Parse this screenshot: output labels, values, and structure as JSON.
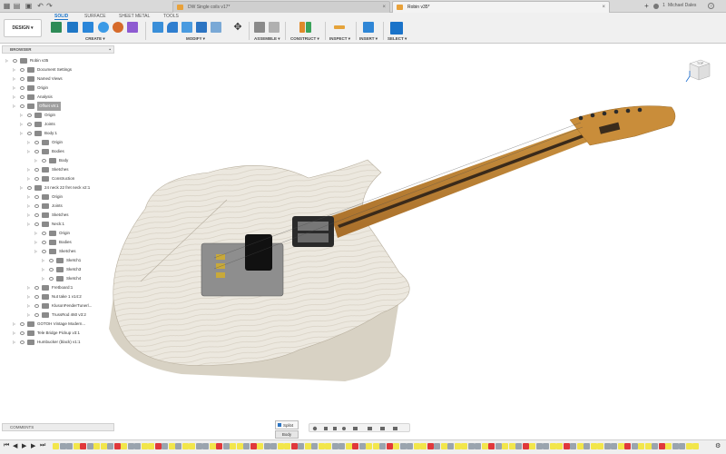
{
  "tabs": [
    {
      "label": "DW Single coils v17*",
      "active": false
    },
    {
      "label": "Robin v35*",
      "active": true
    }
  ],
  "tabbar": {
    "count": "1",
    "user": "Michael Dales"
  },
  "workspace": {
    "label": "DESIGN ▾"
  },
  "ws_tabs": [
    "SOLID",
    "SURFACE",
    "SHEET METAL",
    "TOOLS"
  ],
  "groups": [
    "CREATE ▾",
    "MODIFY ▾",
    "ASSEMBLE ▾",
    "CONSTRUCT ▾",
    "INSPECT ▾",
    "INSERT ▾",
    "SELECT ▾"
  ],
  "browser": {
    "title": "BROWSER",
    "items": [
      {
        "label": "Robin v35",
        "depth": 0
      },
      {
        "label": "Document Settings",
        "depth": 1
      },
      {
        "label": "Named Views",
        "depth": 1
      },
      {
        "label": "Origin",
        "depth": 1
      },
      {
        "label": "Analysis",
        "depth": 1
      },
      {
        "label": "Offset v9:1",
        "depth": 1,
        "selected": true
      },
      {
        "label": "Origin",
        "depth": 2
      },
      {
        "label": "Joints",
        "depth": 2
      },
      {
        "label": "Body:1",
        "depth": 2
      },
      {
        "label": "Origin",
        "depth": 3
      },
      {
        "label": "Bodies",
        "depth": 3
      },
      {
        "label": "Body",
        "depth": 4
      },
      {
        "label": "Sketches",
        "depth": 3
      },
      {
        "label": "Construction",
        "depth": 3
      },
      {
        "label": "24 neck 22 fret neck v2:1",
        "depth": 2
      },
      {
        "label": "Origin",
        "depth": 3
      },
      {
        "label": "Joints",
        "depth": 3
      },
      {
        "label": "Sketches",
        "depth": 3
      },
      {
        "label": "Neck:1",
        "depth": 3
      },
      {
        "label": "Origin",
        "depth": 4
      },
      {
        "label": "Bodies",
        "depth": 4
      },
      {
        "label": "Sketches",
        "depth": 4
      },
      {
        "label": "Sketch1",
        "depth": 5
      },
      {
        "label": "Sketch3",
        "depth": 5
      },
      {
        "label": "Sketch4",
        "depth": 5
      },
      {
        "label": "Fretboard:1",
        "depth": 3
      },
      {
        "label": "Nut take 1 v14:2",
        "depth": 3
      },
      {
        "label": "KlusonFenderTunerl...",
        "depth": 3
      },
      {
        "label": "TrussRod 460 v3:2",
        "depth": 3
      },
      {
        "label": "GOTOH Vintage Modern...",
        "depth": 1
      },
      {
        "label": "Tele Bridge Pickup v3:1",
        "depth": 1
      },
      {
        "label": "Humbucker (black) v1:1",
        "depth": 1
      }
    ]
  },
  "comments": {
    "title": "COMMENTS"
  },
  "tooltip": {
    "title": "Split4",
    "sub": "Body"
  },
  "viewcube": {
    "label": "TOP"
  },
  "colors": {
    "accent": "#1a73c9",
    "timeline_yellow": "#f2e64b",
    "timeline_red": "#e0383b"
  }
}
